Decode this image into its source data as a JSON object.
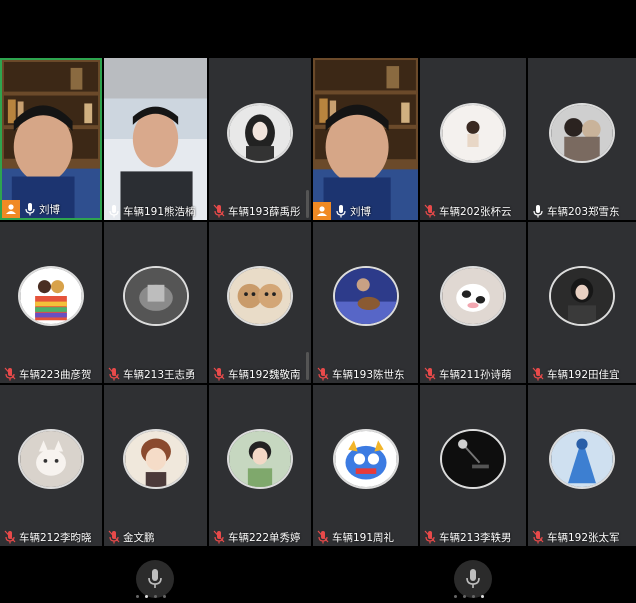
{
  "colors": {
    "tile_bg": "#2f3033",
    "active_border": "#2ea44f",
    "host_badge": "#f08a24",
    "mic_muted": "#e84a4a"
  },
  "tiles": [
    {
      "name": "刘博",
      "kind": "video-host",
      "host": true,
      "muted": false,
      "active": true
    },
    {
      "name": "车辆191熊浩楠",
      "kind": "video",
      "host": false,
      "muted": false,
      "active": false
    },
    {
      "name": "车辆193薛禹彤",
      "kind": "avatar",
      "host": false,
      "muted": true,
      "active": false
    },
    {
      "name": "刘博",
      "kind": "video-host",
      "host": true,
      "muted": false,
      "active": false
    },
    {
      "name": "车辆202张杯云",
      "kind": "avatar",
      "host": false,
      "muted": true,
      "active": false
    },
    {
      "name": "车辆203郑雪东",
      "kind": "avatar",
      "host": false,
      "muted": false,
      "active": false
    },
    {
      "name": "车辆223曲彦贺",
      "kind": "avatar",
      "host": false,
      "muted": true,
      "active": false
    },
    {
      "name": "车辆213王志勇",
      "kind": "avatar",
      "host": false,
      "muted": true,
      "active": false
    },
    {
      "name": "车辆192魏敬南",
      "kind": "avatar",
      "host": false,
      "muted": true,
      "active": false
    },
    {
      "name": "车辆193陈世东",
      "kind": "avatar",
      "host": false,
      "muted": true,
      "active": false
    },
    {
      "name": "车辆211孙诗萌",
      "kind": "avatar",
      "host": false,
      "muted": true,
      "active": false
    },
    {
      "name": "车辆192田佳宜",
      "kind": "avatar",
      "host": false,
      "muted": true,
      "active": false
    },
    {
      "name": "车辆212李昀晓",
      "kind": "avatar",
      "host": false,
      "muted": true,
      "active": false
    },
    {
      "name": "金文鹏",
      "kind": "avatar",
      "host": false,
      "muted": true,
      "active": false
    },
    {
      "name": "车辆222单秀婷",
      "kind": "avatar",
      "host": false,
      "muted": true,
      "active": false
    },
    {
      "name": "车辆191周礼",
      "kind": "avatar",
      "host": false,
      "muted": true,
      "active": false
    },
    {
      "name": "车辆213李轶男",
      "kind": "avatar",
      "host": false,
      "muted": true,
      "active": false
    },
    {
      "name": "车辆192张太军",
      "kind": "avatar",
      "host": false,
      "muted": true,
      "active": false
    }
  ],
  "avatars": [
    "avatar-dark-hair-girl",
    "avatar-white-bg-person",
    "avatar-couple-photo",
    "avatar-rainbow-cartoon",
    "avatar-hands-cup",
    "avatar-cartoon-faces",
    "avatar-guitar-player",
    "avatar-cow-plush",
    "avatar-girl-dark",
    "avatar-white-cat",
    "avatar-anime-boy",
    "avatar-smiling-girl",
    "avatar-blue-monster",
    "avatar-lamp-dark",
    "avatar-blue-figure"
  ],
  "bottom": {
    "pages": [
      false,
      true,
      false,
      false
    ]
  }
}
